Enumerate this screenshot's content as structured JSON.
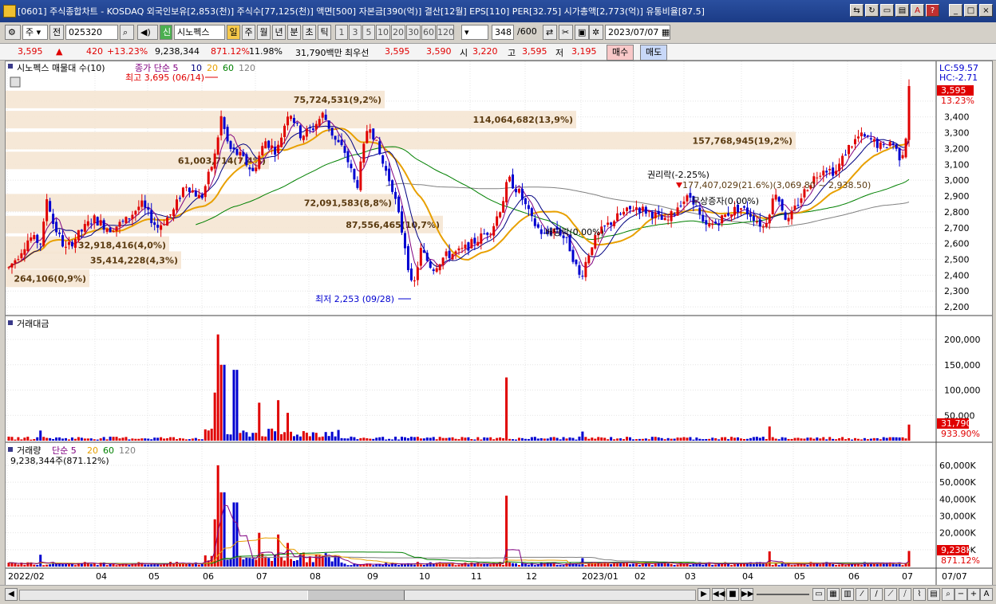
{
  "window": {
    "title": "[0601] 주식종합차트 - KOSDAQ 외국인보유[2,853(천)] 주식수[77,125(천)] 액면[500] 자본금[390(억)] 결산[12월] EPS[110] PER[32.75] 시가총액[2,773(억)] 유통비율[87.5]"
  },
  "toolbar": {
    "market": "주",
    "prev_label": "전",
    "code": "025320",
    "badge": "신",
    "stock_name": "시노펙스",
    "periods": [
      "일",
      "주",
      "월",
      "년",
      "분",
      "초",
      "틱"
    ],
    "selected_period": "일",
    "minute_units": [
      "1",
      "3",
      "5",
      "10",
      "20",
      "30",
      "60",
      "120"
    ],
    "count": "348",
    "count_max": "/600",
    "date": "2023/07/07"
  },
  "quote": {
    "price": "3,595",
    "arrow": "▲",
    "change": "420",
    "change_pct": "+13.23%",
    "volume": "9,238,344",
    "volume_ratio": "871.12%",
    "turnover": "11.98%",
    "amount": "31,790백만",
    "priority_label": "최우선",
    "ask": "3,595",
    "bid": "3,590",
    "open_label": "시",
    "open": "3,220",
    "high_label": "고",
    "high": "3,595",
    "low_label": "저",
    "low": "3,195",
    "buy_label": "매수",
    "sell_label": "매도"
  },
  "price_panel": {
    "header": "시노펙스 매물대 수(10)",
    "ma_header": "종가 단순 5",
    "ma_periods": [
      "10",
      "20",
      "60",
      "120"
    ],
    "lc": "LC:59.57",
    "hc": "HC:-2.71",
    "price_tag": "3,595",
    "pct_tag": "13.23%",
    "high_annot": "최고 3,695 (06/14)",
    "low_annot": "최저 2,253 (09/28)",
    "event_rights": "권리락(-2.25%)",
    "event_dividend": "배당락(0.00%)",
    "event_bonus": "무상증자(0.00%)",
    "ma_annotation": "177,407,029(21.6%)(3,069.80 ~ 2,938.50)",
    "y_ticks": [
      "3,500",
      "3,400",
      "3,300",
      "3,200",
      "3,100",
      "3,000",
      "2,900",
      "2,800",
      "2,700",
      "2,600",
      "2,500",
      "2,400",
      "2,300",
      "2,200"
    ],
    "profile": [
      {
        "label": "264,106(0,9%)",
        "price": 2380
      },
      {
        "label": "35,414,228(4,3%)",
        "price": 2495
      },
      {
        "label": "32,918,416(4,0%)",
        "price": 2590
      },
      {
        "label": "72,091,583(8,8%)",
        "price": 2858
      },
      {
        "label": "87,556,465(10,7%)",
        "price": 2720
      },
      {
        "label": "61,003,714(7,4%)",
        "price": 3125
      },
      {
        "label": "75,724,531(9,2%)",
        "price": 3510
      },
      {
        "label": "114,064,682(13,9%)",
        "price": 3383
      },
      {
        "label": "157,768,945(19,2%)",
        "price": 3250
      }
    ]
  },
  "amount_panel": {
    "header": "거래대금",
    "y_ticks": [
      "200,000",
      "150,000",
      "100,000",
      "50,000"
    ],
    "tag_value": "31,790",
    "tag_pct": "933.90%"
  },
  "volume_panel": {
    "header": "거래량",
    "ma_header": "단순 5",
    "ma_periods": [
      "20",
      "60",
      "120"
    ],
    "current": "9,238,344주(871.12%)",
    "y_ticks": [
      "60,000K",
      "50,000K",
      "40,000K",
      "30,000K",
      "20,000K",
      "10,000K"
    ],
    "tag_value": "9,238K",
    "tag_pct": "871.12%"
  },
  "x_axis": {
    "labels": [
      "2022/02",
      "04",
      "05",
      "06",
      "07",
      "08",
      "09",
      "10",
      "11",
      "12",
      "2023/01",
      "02",
      "03",
      "04",
      "05",
      "06",
      "07",
      "07/07"
    ]
  },
  "colors": {
    "up": "#e00000",
    "down": "#0000d0",
    "ma5": "#800080",
    "ma10": "#000080",
    "ma20": "#e8a000",
    "ma60": "#008000",
    "ma120": "#808080",
    "profile": "#f5e6d3"
  }
}
